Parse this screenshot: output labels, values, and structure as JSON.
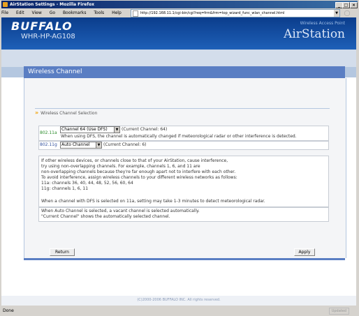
{
  "window": {
    "title": "AirStation Settings - Mozilla Firefox",
    "controls": [
      "_",
      "□",
      "×"
    ]
  },
  "menu": [
    "File",
    "Edit",
    "View",
    "Go",
    "Bookmarks",
    "Tools",
    "Help"
  ],
  "address": {
    "url": "http://192.168.11.1/cgi-bin/cgi?req=frm&frm=top_wizard_func_wlan_channel.html"
  },
  "banner": {
    "logo": "BUFFALO",
    "model": "WHR-HP-AG108",
    "wap_label": "Wireless Access Point",
    "product": "AirStation"
  },
  "panel": {
    "title": "Wireless Channel",
    "section_title": "Wireless Channel Selection"
  },
  "band_a": {
    "label": "802.11a",
    "channel_value": "Channel 64 (Use DFS)",
    "current": "(Current Channel: 64)",
    "dfs_note": "When using DFS, the channel is automatically changed if meteorological radar or other interference is detected."
  },
  "band_g": {
    "label": "802.11g",
    "channel_value": "Auto Channel",
    "current": "(Current Channel: 6)"
  },
  "description": [
    "If other wireless devices, or channels close to that of your AirStation, cause interference,",
    "try using non-overlapping channels. For example, channels 1, 6, and 11 are",
    "non-overlapping channels because they're far enough apart not to interfere with each other.",
    "To avoid interference, assign wireless channels to your different wireless networks as follows:",
    "11a: channels 36, 40, 44, 48, 52, 56, 60, 64",
    "11g: channels 1, 6, 11",
    "",
    "When a channel with DFS is selected on 11a, setting may take 1-3 minutes to detect meteorological radar."
  ],
  "auto_note": [
    "When Auto Channel is selected, a vacant channel is selected automatically.",
    "\"Current Channel\" shows the automatically selected channel."
  ],
  "buttons": {
    "return": "Return",
    "apply": "Apply"
  },
  "footer": {
    "copyright": "(C)2000-2006 BUFFALO INC. All rights reserved."
  },
  "status": {
    "text": "Done",
    "right": "Updated"
  }
}
